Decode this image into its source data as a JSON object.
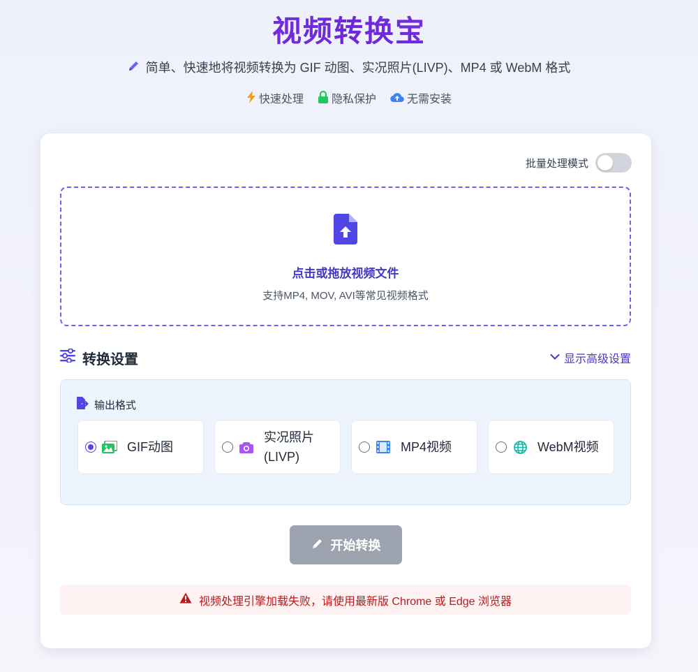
{
  "header": {
    "title": "视频转换宝",
    "subtitle": "简单、快速地将视频转换为 GIF 动图、实况照片(LIVP)、MP4 或 WebM 格式",
    "features": [
      {
        "icon": "lightning-icon",
        "label": "快速处理"
      },
      {
        "icon": "lock-icon",
        "label": "隐私保护"
      },
      {
        "icon": "cloud-upload-icon",
        "label": "无需安装"
      }
    ]
  },
  "batch": {
    "label": "批量处理模式",
    "enabled": false
  },
  "dropzone": {
    "title": "点击或拖放视频文件",
    "hint": "支持MP4, MOV, AVI等常见视频格式"
  },
  "settings": {
    "title": "转换设置",
    "advanced_label": "显示高级设置",
    "output_format_label": "输出格式",
    "options": [
      {
        "label": "GIF动图",
        "checked": true,
        "icon": "image-icon"
      },
      {
        "label": "实况照片 (LIVP)",
        "line1": "实况照片",
        "line2": "(LIVP)",
        "checked": false,
        "icon": "camera-icon"
      },
      {
        "label": "MP4视频",
        "checked": false,
        "icon": "film-icon"
      },
      {
        "label": "WebM视频",
        "checked": false,
        "icon": "globe-icon"
      }
    ]
  },
  "start_button": {
    "label": "开始转换",
    "disabled": true
  },
  "error": {
    "message": "视频处理引擎加载失败，请使用最新版 Chrome 或 Edge 浏览器"
  },
  "colors": {
    "accent": "#4f46e5",
    "title_gradient": "#7c3aed",
    "error_text": "#b91c1c",
    "error_bg": "#fef2f2",
    "disabled_button": "#9ca3af"
  }
}
